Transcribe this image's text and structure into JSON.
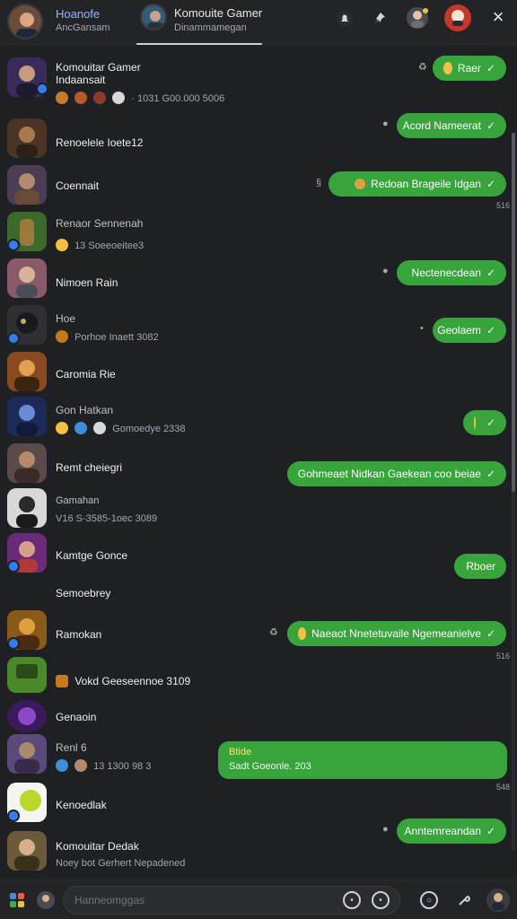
{
  "header": {
    "left_name": "Hoanofe",
    "left_status": "AncGansam",
    "chat_title": "Komouite Gamer",
    "chat_subtitle": "Dinammamegan",
    "icons": [
      "bell-icon",
      "pin-icon",
      "user-icon",
      "game-icon"
    ],
    "close_label": "×"
  },
  "list": {
    "items": [
      {
        "title": "Komouitar Gamer Indaansait",
        "sub": "· 1031  G00.000 5006"
      },
      {
        "title": "Renoelele Ioete12",
        "sub": ""
      },
      {
        "title": "Coennait",
        "sub": ""
      },
      {
        "title": "Renaor Sennenah",
        "sub": "13  Soeeoeitee3"
      },
      {
        "title": "Nimoen Rain",
        "sub": ""
      },
      {
        "title": "Hoe",
        "sub": "Porhoe Inaett 3082"
      },
      {
        "title": "Caromia Rie",
        "sub": ""
      },
      {
        "title": "Gon Hatkan",
        "sub": "Gomoedye 2338"
      },
      {
        "title": "Remt cheiegri",
        "sub": ""
      },
      {
        "title": "Gamahan",
        "sub": "V16 S-3585-1oec 3089"
      },
      {
        "title": "Kamtge Gonce",
        "sub": ""
      },
      {
        "title": "Semoebrey",
        "sub": ""
      },
      {
        "title": "Ramokan",
        "sub": ""
      },
      {
        "title": "Vokd Geeseennoe 3109",
        "sub": ""
      },
      {
        "title": "Genaoin",
        "sub": ""
      },
      {
        "title": "Renl 6",
        "sub": "13  1300 98 3"
      },
      {
        "title": "Kenoedlak",
        "sub": ""
      },
      {
        "title": "Komouitar Dedak",
        "sub": "Noey bot Gerhert Nepadened"
      }
    ]
  },
  "chat": {
    "bubbles": [
      {
        "text": "Raer",
        "time": ""
      },
      {
        "text": "Acord Nameerat",
        "time": ""
      },
      {
        "text": "Redoan Brageile Idgan",
        "time": "516"
      },
      {
        "text": "Nectenecdean",
        "time": ""
      },
      {
        "text": "Geolaem",
        "time": ""
      },
      {
        "text": "",
        "time": ""
      },
      {
        "text": "Gohmeaet Nidkan Gaekean coo beiae",
        "time": ""
      },
      {
        "text": "Rboer",
        "time": ""
      },
      {
        "text": "Naeaot Nnetetuvaile Ngemeanielve",
        "time": "516"
      },
      {
        "text": "Anntemreandan",
        "time": ""
      }
    ],
    "big_bubble": {
      "title": "Btide",
      "text": "Sadt Goeonle. 203",
      "time": "548"
    }
  },
  "footer": {
    "placeholder": "Hanneomggas"
  },
  "colors": {
    "background": "#1f2023",
    "bubble_green": "#37a53b",
    "accent_blue": "#2f7ef7"
  }
}
